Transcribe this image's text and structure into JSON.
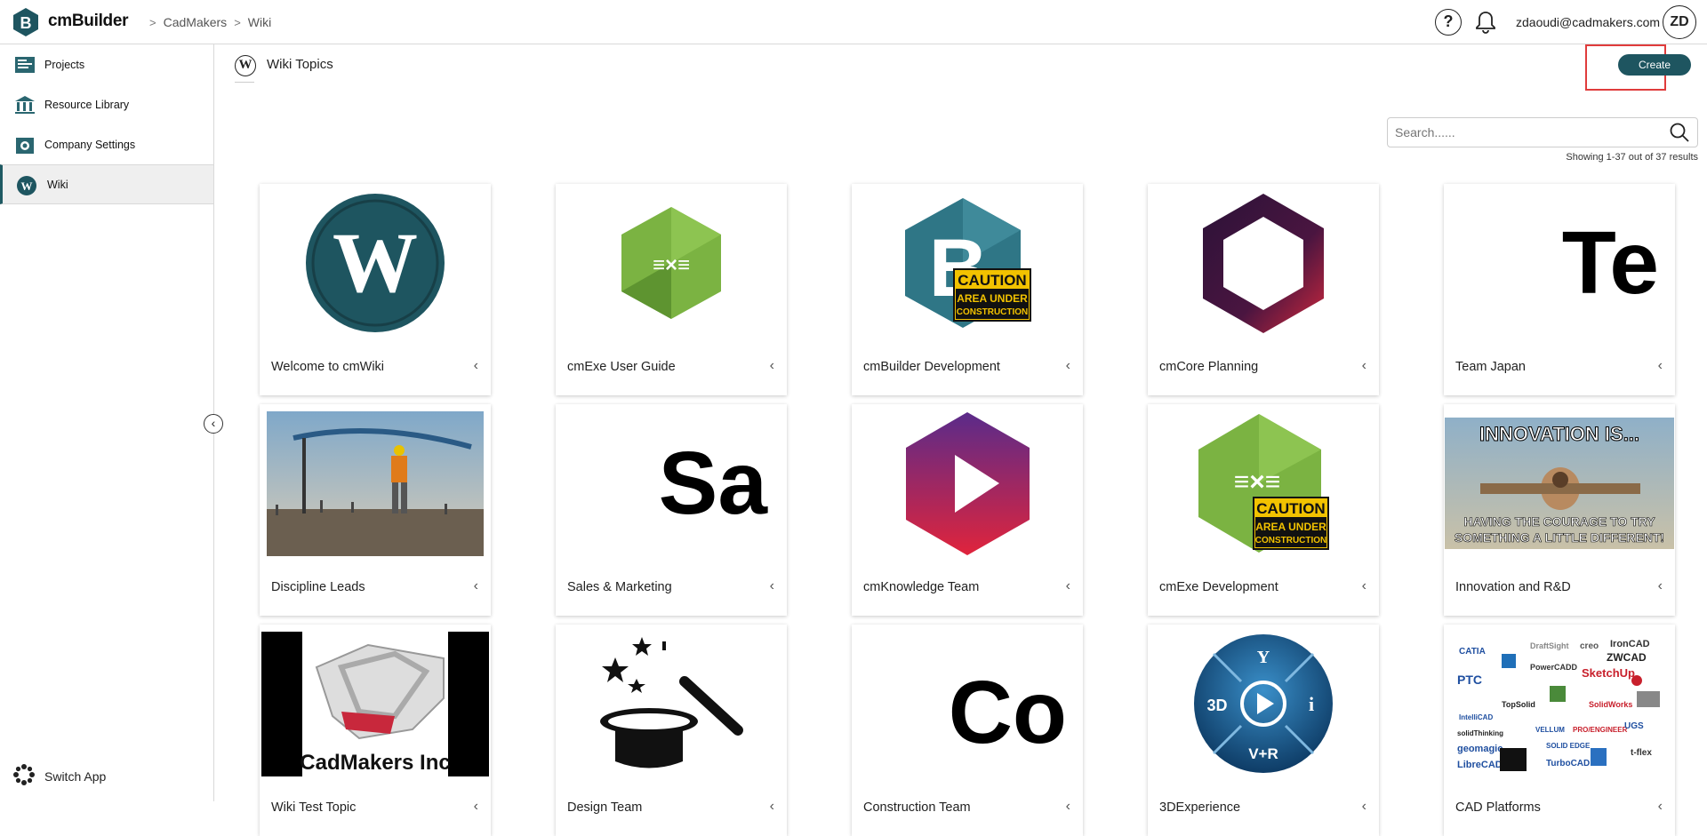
{
  "app": {
    "name": "cmBuilder"
  },
  "breadcrumb": [
    "CadMakers",
    "Wiki"
  ],
  "header": {
    "user_email": "zdaoudi@cadmakers.com",
    "avatar_initials": "ZD",
    "help_glyph": "?"
  },
  "sidebar": {
    "items": [
      {
        "label": "Projects",
        "icon": "projects-icon"
      },
      {
        "label": "Resource Library",
        "icon": "library-icon"
      },
      {
        "label": "Company Settings",
        "icon": "settings-icon"
      },
      {
        "label": "Wiki",
        "icon": "wiki-icon",
        "active": true
      }
    ],
    "switch_app": "Switch App"
  },
  "main": {
    "title": "Wiki Topics",
    "create_label": "Create",
    "search_placeholder": "Search......",
    "results_text": "Showing 1-37 out of 37 results"
  },
  "cards": [
    {
      "label": "Welcome to cmWiki",
      "thumb": "wiki-logo"
    },
    {
      "label": "cmExe User Guide",
      "thumb": "cmexe-hex"
    },
    {
      "label": "cmBuilder Development",
      "thumb": "cmbuilder-caution"
    },
    {
      "label": "cmCore Planning",
      "thumb": "cmcore-hex"
    },
    {
      "label": "Team Japan",
      "thumb": "text",
      "thumb_text": "Te"
    },
    {
      "label": "Discipline Leads",
      "thumb": "construction-photo"
    },
    {
      "label": "Sales & Marketing",
      "thumb": "text",
      "thumb_text": "Sa"
    },
    {
      "label": "cmKnowledge Team",
      "thumb": "play-hex"
    },
    {
      "label": "cmExe Development",
      "thumb": "cmexe-caution"
    },
    {
      "label": "Innovation and R&D",
      "thumb": "innovation-meme"
    },
    {
      "label": "Wiki Test Topic",
      "thumb": "cadmakers-logo"
    },
    {
      "label": "Design Team",
      "thumb": "magic-hat"
    },
    {
      "label": "Construction Team",
      "thumb": "text",
      "thumb_text": "Co"
    },
    {
      "label": "3DExperience",
      "thumb": "3dx-compass"
    },
    {
      "label": "CAD Platforms",
      "thumb": "cad-logos"
    }
  ],
  "thumb_text": {
    "caution": "CAUTION",
    "area_under": "AREA UNDER",
    "construction": "CONSTRUCTION",
    "innovation_top": "INNOVATION IS...",
    "innovation_bottom1": "HAVING THE COURAGE TO TRY",
    "innovation_bottom2": "SOMETHING A LITTLE DIFFERENT!",
    "cadmakers": "CadMakers Inc",
    "dx_3d": "3D",
    "dx_vr": "V+R",
    "cad_logos": [
      "CATIA",
      "ZWCAD",
      "PTC",
      "SketchUp",
      "IronCAD",
      "creo",
      "DraftSight",
      "PowerCADD",
      "TopSolid",
      "SolidWorks",
      "IntelliCAD",
      "solidThinking",
      "VELLUM",
      "PRO/ENGINEER",
      "UGS",
      "geomagic",
      "LibreCAD",
      "SOLID EDGE",
      "TurboCAD",
      "t-flex"
    ]
  },
  "colors": {
    "accent": "#1e5560",
    "highlight": "#e03c3c"
  }
}
